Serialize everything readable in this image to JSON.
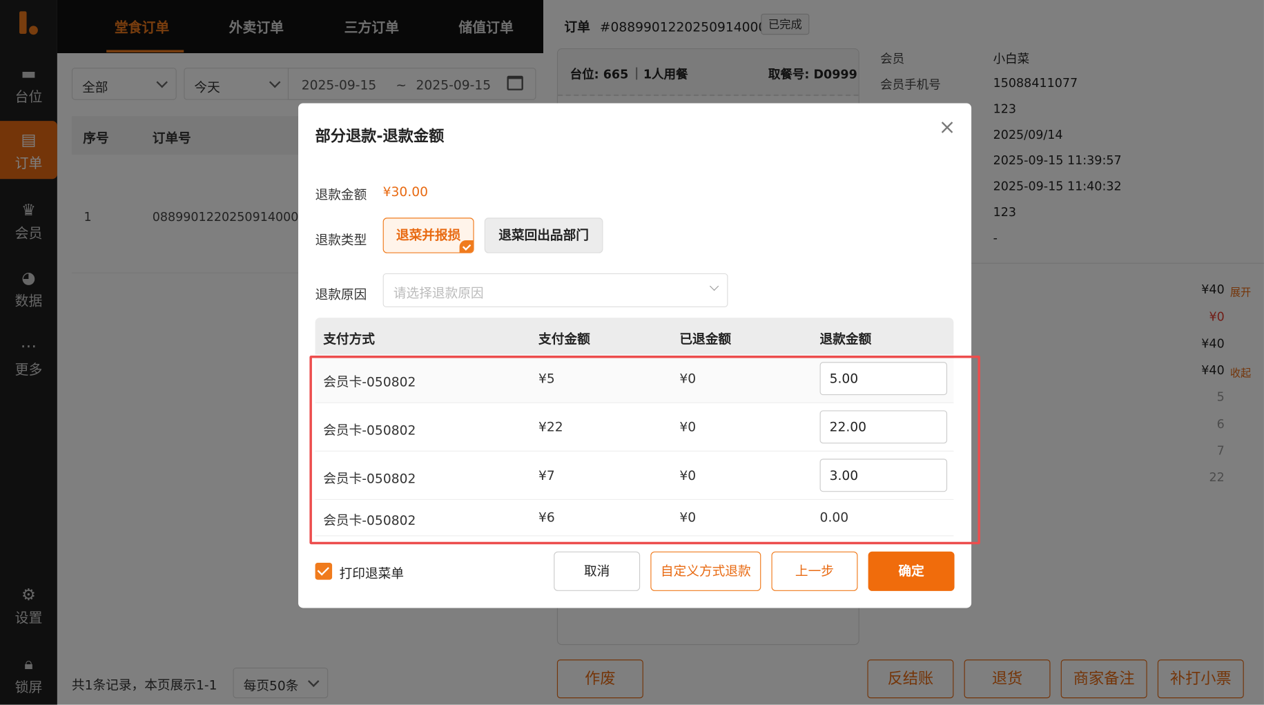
{
  "sidebar": {
    "items": [
      {
        "name": "tables",
        "icon": "table-icon",
        "label": "台位"
      },
      {
        "name": "orders",
        "icon": "order-icon",
        "label": "订单"
      },
      {
        "name": "members",
        "icon": "member-icon",
        "label": "会员"
      },
      {
        "name": "data",
        "icon": "pie-chart-icon",
        "label": "数据"
      },
      {
        "name": "more",
        "icon": "more-icon",
        "label": "更多"
      },
      {
        "name": "settings",
        "icon": "gear-icon",
        "label": "设置"
      },
      {
        "name": "lock",
        "icon": "lock-icon",
        "label": "锁屏"
      }
    ],
    "active_color": "#e86a12"
  },
  "top_tabs": [
    "堂食订单",
    "外卖订单",
    "三方订单",
    "储值订单"
  ],
  "filters": {
    "scope": "全部",
    "period": "今天",
    "date_start": "2025-09-15",
    "date_sep": "~",
    "date_end": "2025-09-15"
  },
  "order_table": {
    "headers": [
      "序号",
      "订单号"
    ],
    "rows": [
      {
        "index": "1",
        "order_no": "08899012202509140001"
      }
    ]
  },
  "pagination": {
    "summary": "共1条记录，本页展示1-1",
    "page_size": "每页50条"
  },
  "order_detail": {
    "title": "订单",
    "order_no": "#08899012202509140001",
    "status": "已完成",
    "table": "台位: 665",
    "party": "1人用餐",
    "pickup": "取餐号: D0999",
    "info": [
      {
        "label": "会员",
        "value": "小白菜"
      },
      {
        "label": "会员手机号",
        "value": "15088411077"
      },
      {
        "label": "",
        "value": "123"
      },
      {
        "label": "",
        "value": "2025/09/14"
      },
      {
        "label": "",
        "value": "2025-09-15 11:39:57"
      },
      {
        "label": "",
        "value": "2025-09-15 11:40:32"
      },
      {
        "label": "",
        "value": "123"
      },
      {
        "label": "",
        "value": "-"
      }
    ],
    "amounts": [
      {
        "value": "¥40",
        "toggle": "展开"
      },
      {
        "value": "¥0"
      },
      {
        "value": "¥40"
      },
      {
        "value": "¥40",
        "toggle": "收起"
      },
      {
        "value": "5"
      },
      {
        "value": "6"
      },
      {
        "value": "7"
      },
      {
        "value": "22"
      }
    ],
    "actions": {
      "void": "作废",
      "reverse": "反结账",
      "return": "退货",
      "merchant_note": "商家备注",
      "reprint": "补打小票"
    }
  },
  "modal": {
    "title": "部分退款-退款金额",
    "refund_amount_label": "退款金额",
    "refund_amount": "¥30.00",
    "refund_type_label": "退款类型",
    "type_selected": "退菜并报损",
    "type_other": "退菜回出品部门",
    "reason_label": "退款原因",
    "reason_placeholder": "请选择退款原因",
    "table_headers": [
      "支付方式",
      "支付金额",
      "已退金额",
      "退款金额"
    ],
    "rows": [
      {
        "method": "会员卡-050802",
        "paid": "¥5",
        "refunded": "¥0",
        "refund": "5.00",
        "editable": true
      },
      {
        "method": "会员卡-050802",
        "paid": "¥22",
        "refunded": "¥0",
        "refund": "22.00",
        "editable": true
      },
      {
        "method": "会员卡-050802",
        "paid": "¥7",
        "refunded": "¥0",
        "refund": "3.00",
        "editable": true
      },
      {
        "method": "会员卡-050802",
        "paid": "¥6",
        "refunded": "¥0",
        "refund": "0.00",
        "editable": false
      }
    ],
    "print_label": "打印退菜单",
    "print_checked": true,
    "buttons": {
      "cancel": "取消",
      "custom": "自定义方式退款",
      "prev": "上一步",
      "confirm": "确定"
    }
  }
}
